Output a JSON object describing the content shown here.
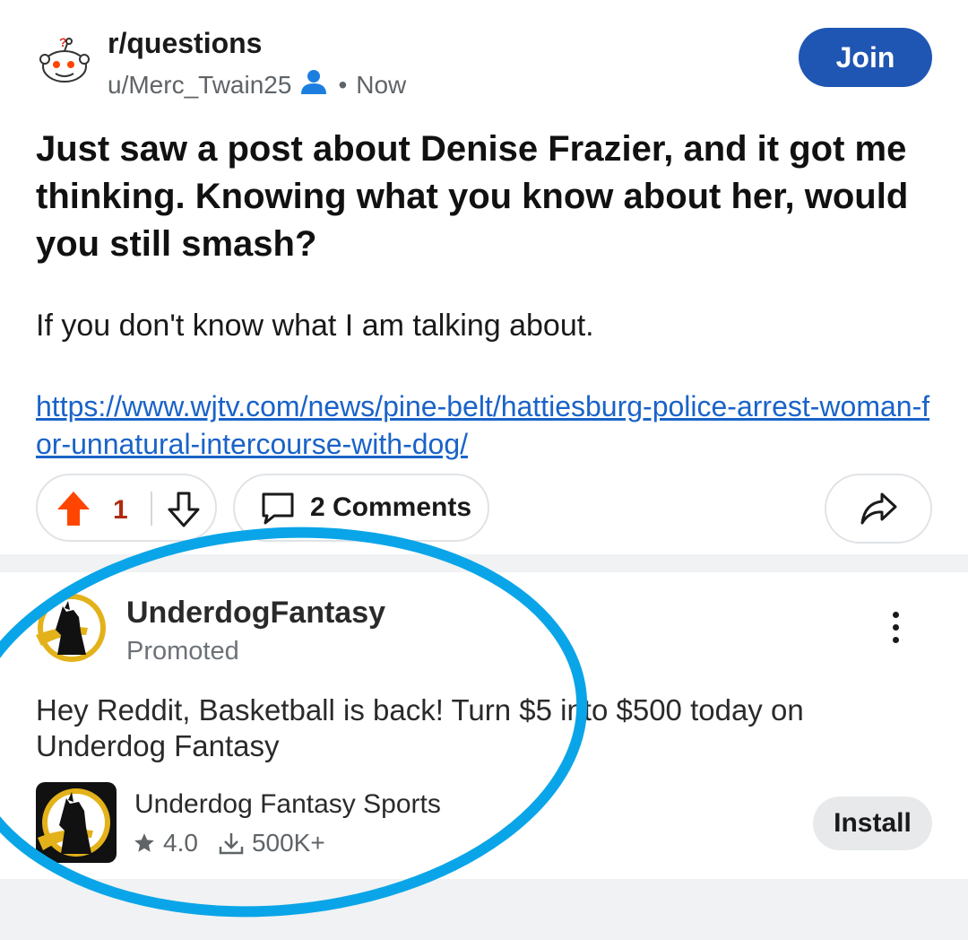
{
  "post": {
    "subreddit": "r/questions",
    "author": "u/Merc_Twain25",
    "separator": "•",
    "time": "Now",
    "join_label": "Join",
    "title": "Just saw a post about Denise Frazier, and it got me thinking. Knowing what you know about her, would you still smash?",
    "body": "If you don't know what I am talking about.",
    "link": "https://www.wjtv.com/news/pine-belt/hattiesburg-police-arrest-woman-for-unnatural-intercourse-with-dog/",
    "vote_count": "1",
    "comments_label": "2 Comments",
    "icons": [
      "snoo-avatar-icon",
      "user-icon",
      "upvote-icon",
      "downvote-icon",
      "comment-icon",
      "share-icon"
    ]
  },
  "ad": {
    "advertiser": "UnderdogFantasy",
    "promoted_label": "Promoted",
    "text": "Hey Reddit, Basketball is back! Turn $5 into $500 today on Underdog Fantasy",
    "app_name": "Underdog Fantasy Sports",
    "rating": "4.0",
    "downloads": "500K+",
    "install_label": "Install",
    "icons": [
      "underdog-logo-icon",
      "more-options-icon",
      "star-icon",
      "download-icon"
    ]
  },
  "colors": {
    "join_bg": "#1f56b3",
    "link": "#1a63c8",
    "upvote": "#ff4500",
    "vote_count": "#b02a10",
    "annotation_circle": "#0aa5e8",
    "separator_bg": "#f0f2f3",
    "logo_yellow": "#e3b21a"
  }
}
